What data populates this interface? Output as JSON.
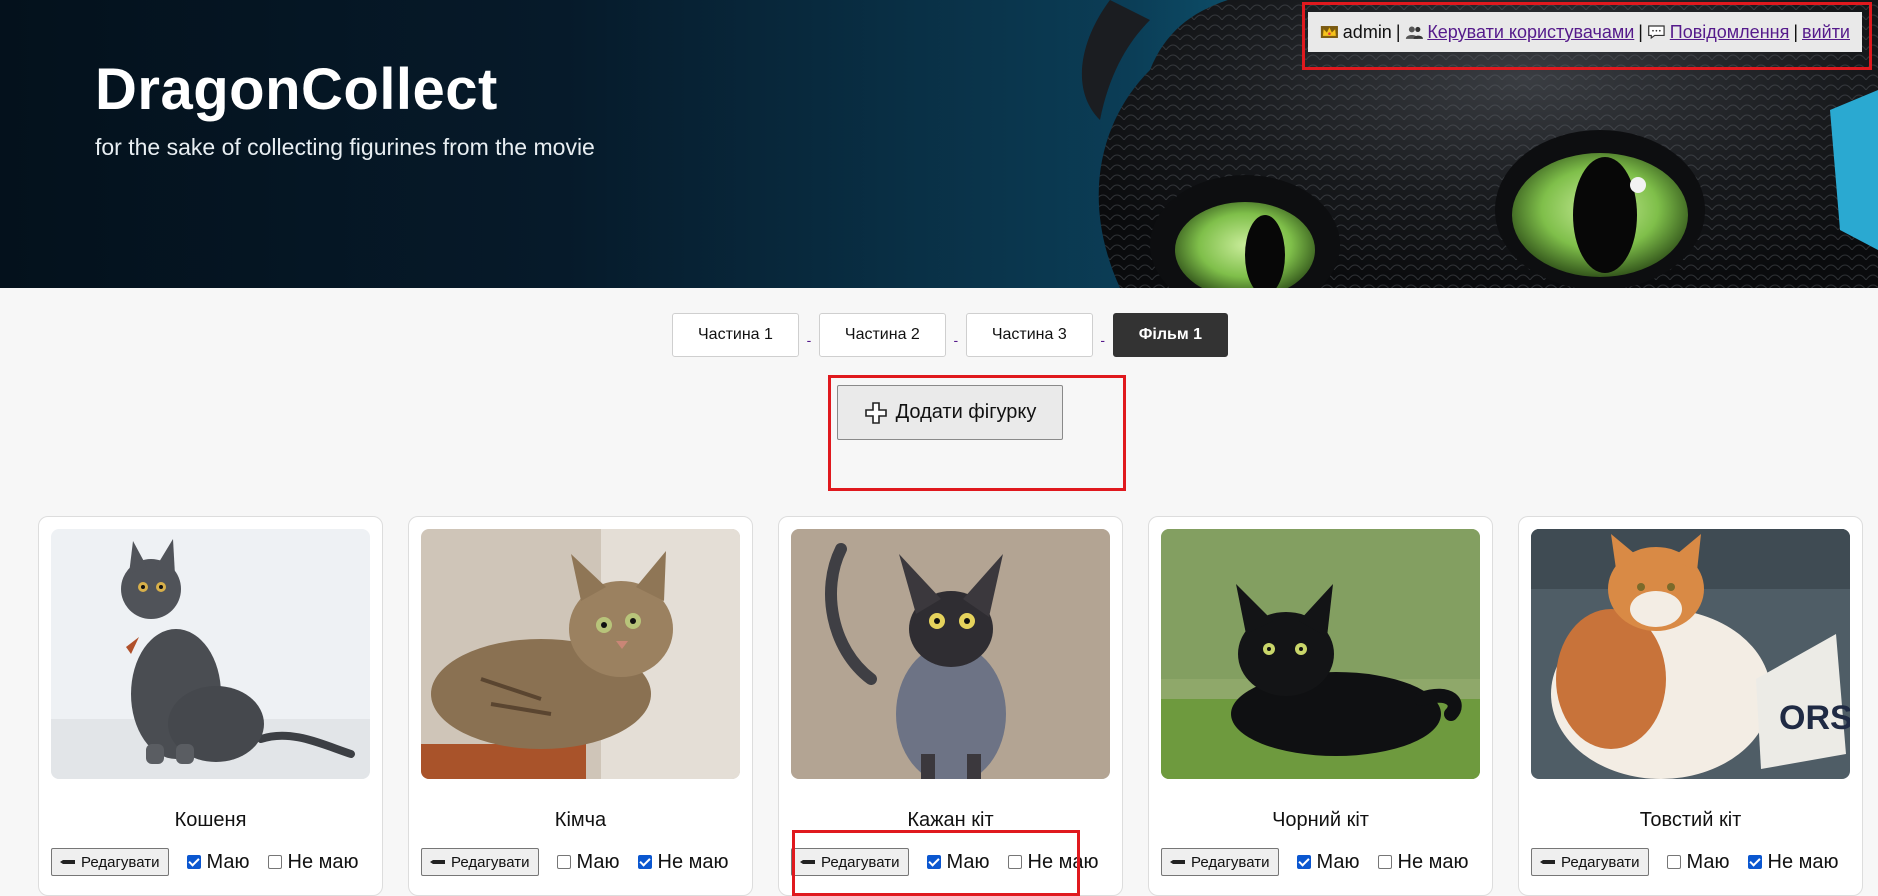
{
  "header": {
    "title": "DragonCollect",
    "subtitle": "for the sake of collecting figurines from the movie"
  },
  "user_bar": {
    "crown_icon": "crown-icon",
    "username": "admin",
    "users_icon": "users-icon",
    "manage_users": "Керувати користувачами",
    "messages_icon": "speech-bubble-icon",
    "messages": "Повідомлення",
    "logout": "вийти",
    "separator": "|"
  },
  "tabs": [
    {
      "label": "Частина 1",
      "active": false
    },
    {
      "label": "Частина 2",
      "active": false
    },
    {
      "label": "Частина 3",
      "active": false
    },
    {
      "label": "Фільм 1",
      "active": true
    }
  ],
  "tab_separator": "-",
  "add_button": {
    "label": "Додати фігурку",
    "icon": "plus-icon"
  },
  "card_labels": {
    "edit": "Редагувати",
    "have": "Маю",
    "not_have": "Не маю",
    "edit_icon": "pencil-icon"
  },
  "cards": [
    {
      "name": "Кошеня",
      "have": true,
      "not_have": false,
      "photo": "gray-kitten"
    },
    {
      "name": "Кімча",
      "have": false,
      "not_have": true,
      "photo": "tabby-cat"
    },
    {
      "name": "Кажан кіт",
      "have": true,
      "not_have": false,
      "photo": "sphynx-cat"
    },
    {
      "name": "Чорний кіт",
      "have": true,
      "not_have": false,
      "photo": "black-cat"
    },
    {
      "name": "Товстий кіт",
      "have": false,
      "not_have": true,
      "photo": "fat-orange-cat"
    }
  ],
  "colors": {
    "highlight": "#e0191e",
    "link": "#551a8b",
    "active_tab": "#333333"
  }
}
